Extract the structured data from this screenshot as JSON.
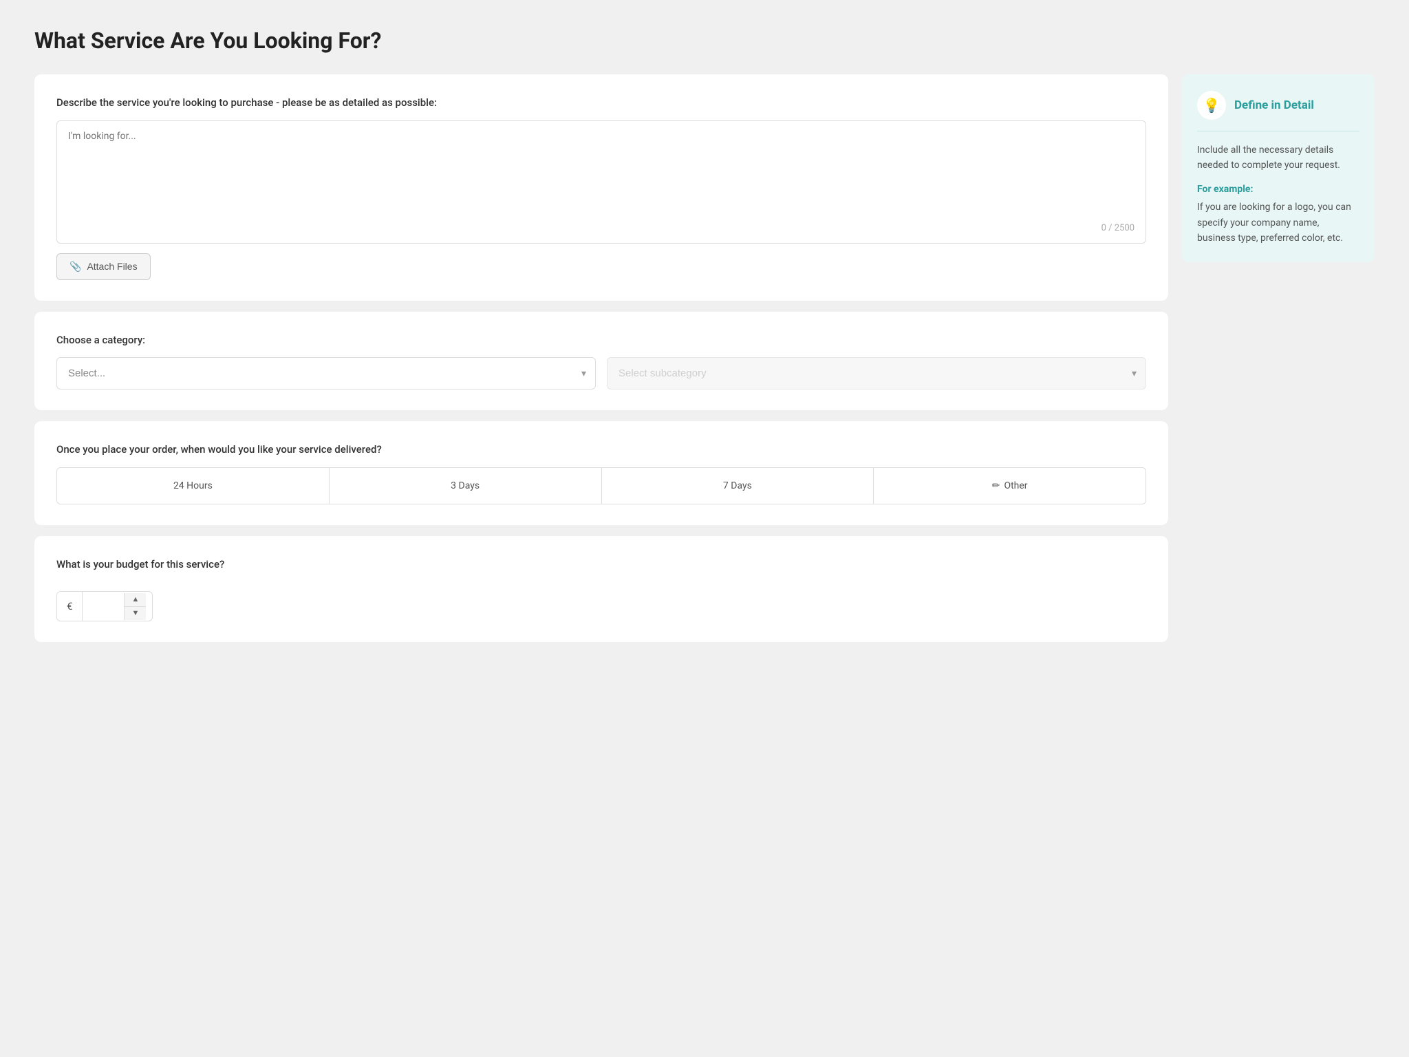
{
  "page": {
    "title": "What Service Are You Looking For?"
  },
  "description_section": {
    "label": "Describe the service you're looking to purchase - please be as detailed as possible:",
    "textarea_placeholder": "I'm looking for...",
    "char_count": "0 / 2500",
    "attach_button_label": "Attach Files"
  },
  "category_section": {
    "label": "Choose a category:",
    "category_placeholder": "Select...",
    "subcategory_placeholder": "Select subcategory"
  },
  "delivery_section": {
    "label": "Once you place your order, when would you like your service delivered?",
    "options": [
      {
        "label": "24 Hours",
        "id": "24hours"
      },
      {
        "label": "3 Days",
        "id": "3days"
      },
      {
        "label": "7 Days",
        "id": "7days"
      },
      {
        "label": "Other",
        "id": "other",
        "has_icon": true
      }
    ]
  },
  "budget_section": {
    "label": "What is your budget for this service?",
    "currency_symbol": "€"
  },
  "info_panel": {
    "title": "Define in Detail",
    "body": "Include all the necessary details needed to complete your request.",
    "example_label": "For example:",
    "example_text": "If you are looking for a logo, you can specify your company name, business type, preferred color, etc."
  },
  "icons": {
    "bulb": "💡",
    "paperclip": "📎",
    "pencil": "✏"
  }
}
